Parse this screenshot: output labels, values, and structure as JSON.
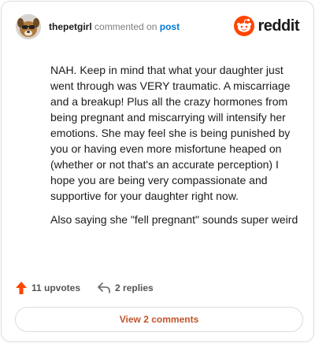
{
  "comment": {
    "username": "thepetgirl",
    "verb": "commented on",
    "post_link": "post",
    "paragraphs": [
      "NAH. Keep in mind that what your daughter just went through was VERY traumatic. A miscarriage and a breakup! Plus all the crazy hormones from being pregnant and miscarrying will intensify her emotions. She may feel she is being punished by you or having even more misfortune heaped on (whether or not that's an accurate perception) I hope you are being very compassionate and supportive for your daughter right now.",
      "Also saying she \"fell pregnant\" sounds super weird"
    ],
    "upvotes_label": "11 upvotes",
    "replies_label": "2 replies",
    "view_comments_label": "View 2 comments"
  },
  "brand": {
    "name": "reddit",
    "icon": "reddit-logo-icon"
  },
  "icons": {
    "upvote": "upvote-arrow-icon",
    "reply": "reply-arrow-icon",
    "avatar": "user-avatar"
  },
  "colors": {
    "brand": "#ff4500",
    "link": "#0079d3",
    "upvote": "#ff4500",
    "view_button_text": "#c0542b"
  }
}
